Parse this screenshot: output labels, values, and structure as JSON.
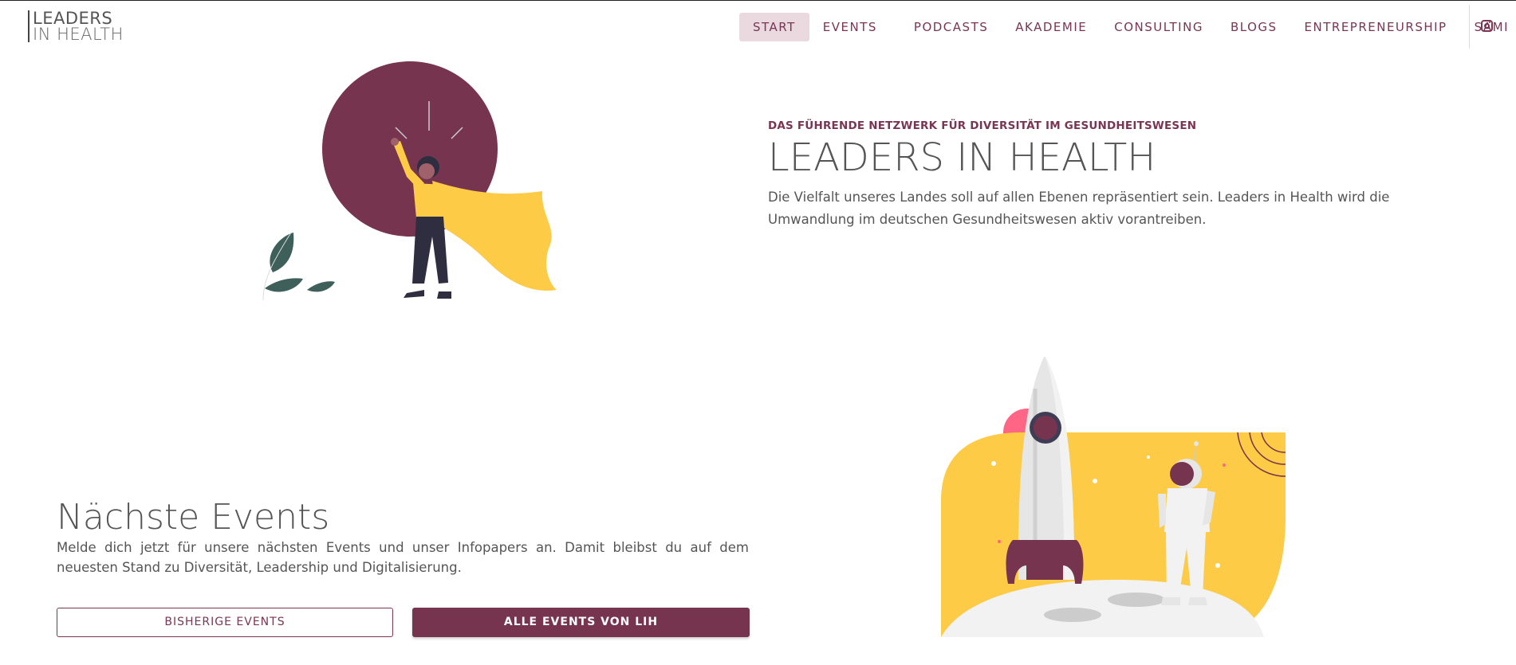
{
  "header": {
    "logo_line1": "LEADERS",
    "logo_line2": "IN HEALTH",
    "nav": [
      {
        "label": "START",
        "active": true
      },
      {
        "label": "EVENTS",
        "active": false
      },
      {
        "label": "PODCASTS",
        "active": false
      },
      {
        "label": "AKADEMIE",
        "active": false
      },
      {
        "label": "CONSULTING",
        "active": false
      },
      {
        "label": "BLOGS",
        "active": false
      },
      {
        "label": "ENTREPRENEURSHIP",
        "active": false
      },
      {
        "label": "SAMI",
        "active": false
      }
    ],
    "social_icon": "instagram-icon"
  },
  "hero": {
    "eyebrow": "DAS FÜHRENDE NETZWERK FÜR DIVERSITÄT IM GESUNDHEITSWESEN",
    "title": "LEADERS IN HEALTH",
    "description": "Die Vielfalt unseres Landes soll auf allen Ebenen repräsentiert sein. Leaders in Health wird die Umwandlung im deutschen Gesundheitswesen aktiv vorantreiben."
  },
  "events": {
    "title": "Nächste Events",
    "description": "Melde dich jetzt für unsere nächsten Events und unser Infopapers an. Damit bleibst du auf dem neuesten Stand zu Diversität, Leadership und Digitalisierung.",
    "button_past": "BISHERIGE EVENTS",
    "button_all": "ALLE EVENTS VON LIH"
  },
  "colors": {
    "brand": "#76344f",
    "accent_yellow": "#fecb47",
    "nav_active_bg": "#ead9df",
    "leaf_green": "#3f5f5a"
  }
}
